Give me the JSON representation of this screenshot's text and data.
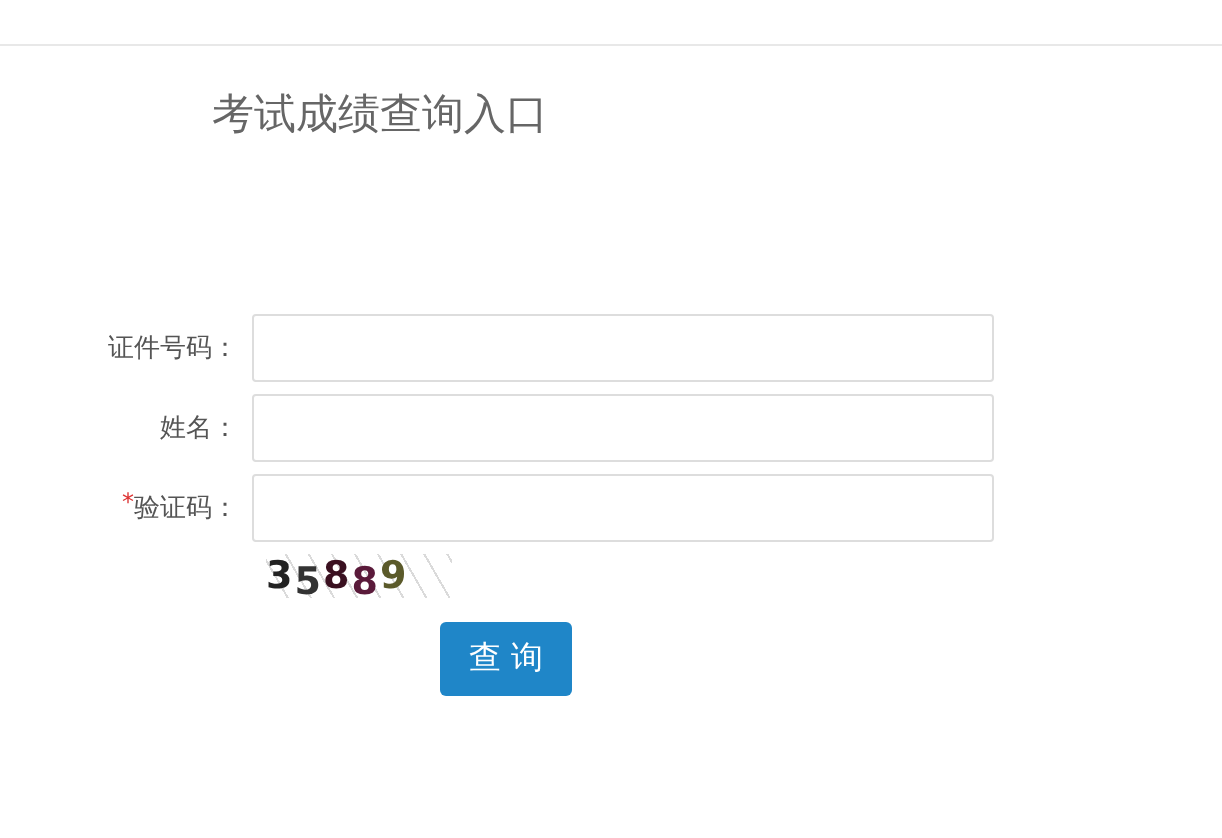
{
  "title": "考试成绩查询入口",
  "fields": [
    {
      "label": "证件号码：",
      "required": false
    },
    {
      "label": "姓名：",
      "required": false
    },
    {
      "label": "验证码：",
      "required": true
    }
  ],
  "required_mark": "*",
  "captcha": {
    "text": "35889"
  },
  "submit": {
    "label": "查 询"
  }
}
